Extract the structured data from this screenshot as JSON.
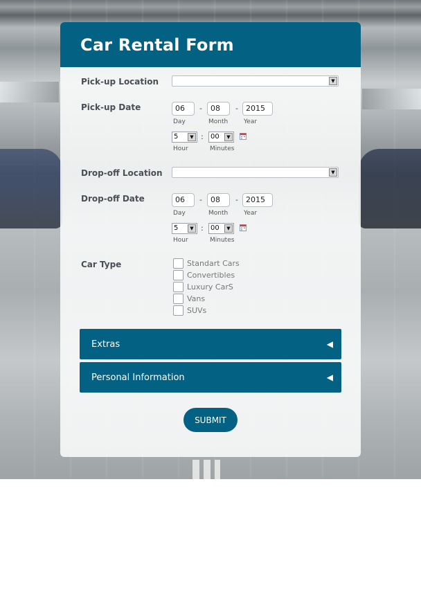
{
  "form": {
    "title": "Car Rental Form",
    "pickup_location": {
      "label": "Pick-up Location",
      "value": ""
    },
    "pickup_date": {
      "label": "Pick-up Date",
      "day": "06",
      "month": "08",
      "year": "2015",
      "day_label": "Day",
      "month_label": "Month",
      "year_label": "Year",
      "hour": "5",
      "minutes": "00",
      "hour_label": "Hour",
      "minutes_label": "Minutes"
    },
    "dropoff_location": {
      "label": "Drop-off Location",
      "value": ""
    },
    "dropoff_date": {
      "label": "Drop-off Date",
      "day": "06",
      "month": "08",
      "year": "2015",
      "day_label": "Day",
      "month_label": "Month",
      "year_label": "Year",
      "hour": "5",
      "minutes": "00",
      "hour_label": "Hour",
      "minutes_label": "Minutes"
    },
    "car_type": {
      "label": "Car Type",
      "options": [
        "Standart Cars",
        "Convertibles",
        "Luxury CarS",
        "Vans",
        "SUVs"
      ]
    },
    "sections": [
      {
        "label": "Extras",
        "icon": "collapse-arrow-icon"
      },
      {
        "label": "Personal Information",
        "icon": "collapse-arrow-icon"
      }
    ],
    "submit_label": "SUBMIT",
    "separators": {
      "date": "-",
      "time": ":"
    },
    "colors": {
      "primary": "#036184",
      "panel": "#f8f9fa"
    }
  }
}
